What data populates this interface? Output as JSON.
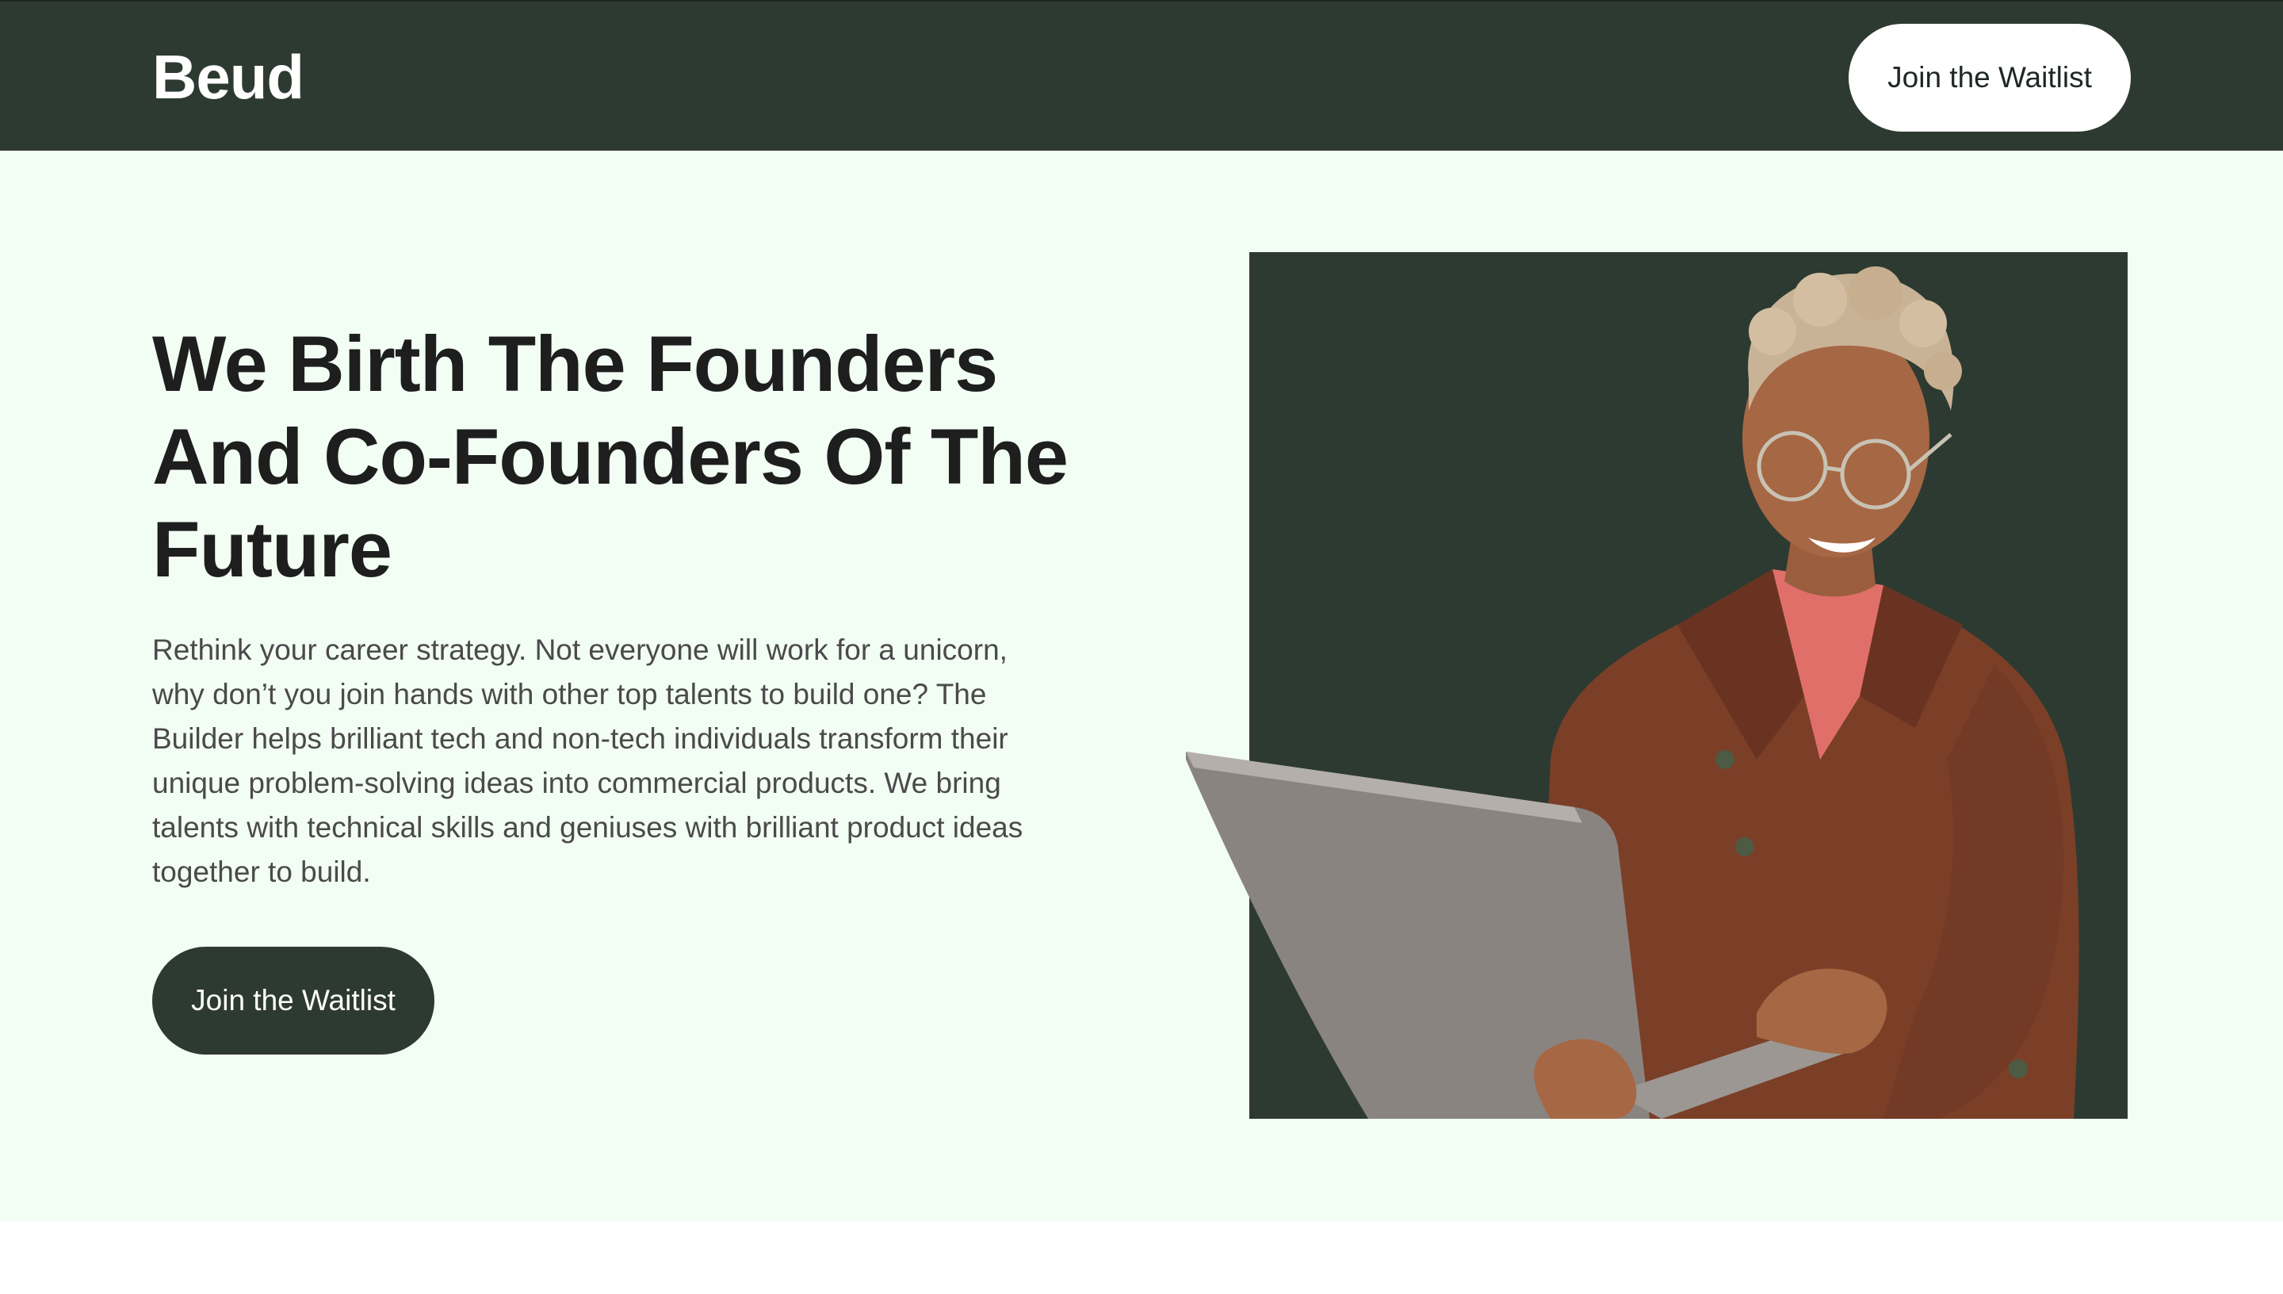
{
  "header": {
    "logo": "Beud",
    "cta_label": "Join the Waitlist"
  },
  "hero": {
    "headline": "We Birth The Founders And Co-Founders Of The Future",
    "description": "Rethink your career strategy. Not everyone will work for a unicorn, why don’t you join hands with other top talents to build one? The Builder helps brilliant tech and non-tech individuals transform their unique problem-solving ideas into commercial products. We bring talents with technical skills and geniuses with brilliant product ideas together to build.",
    "cta_label": "Join the Waitlist"
  },
  "colors": {
    "brand_dark": "#2d3a31",
    "hero_background": "#f2fdf4",
    "button_light": "#ffffff"
  }
}
